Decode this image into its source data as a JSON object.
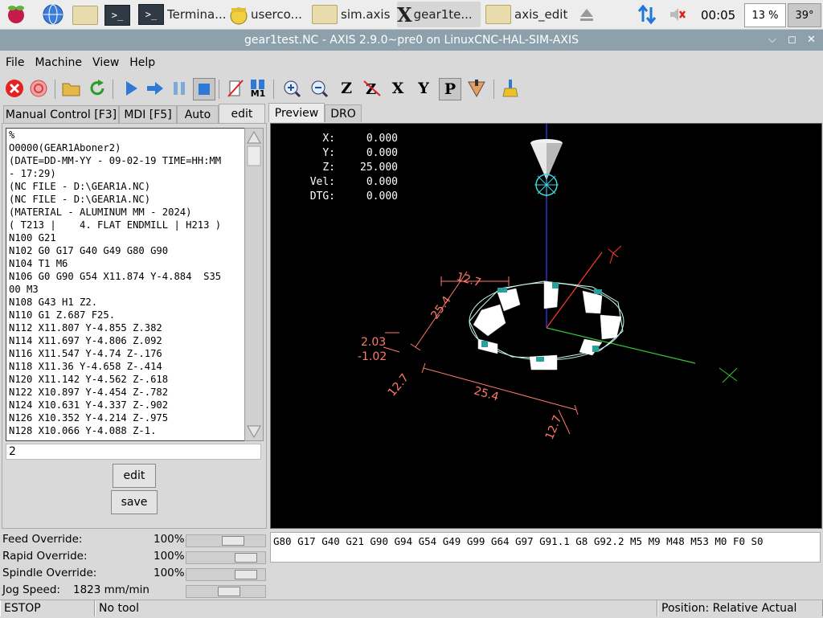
{
  "taskbar": {
    "tasks": [
      {
        "label": "Termina..."
      },
      {
        "label": "userco..."
      },
      {
        "label": "sim.axis"
      },
      {
        "label": "gear1te..."
      },
      {
        "label": "axis_edit"
      }
    ],
    "clock": "00:05",
    "cpu": "13 %",
    "temp": "39°",
    "icons": [
      "raspberry-icon",
      "globe-icon",
      "folder-icon",
      "terminal-icon",
      "eject-icon",
      "network-icon",
      "volume-muted-icon"
    ]
  },
  "window": {
    "title": "gear1test.NC - AXIS 2.9.0~pre0 on LinuxCNC-HAL-SIM-AXIS"
  },
  "menu": {
    "file": "File",
    "machine": "Machine",
    "view": "View",
    "help": "Help"
  },
  "toolbar": {
    "z": "Z",
    "x": "X",
    "y": "Y",
    "p": "P",
    "m1": "M1"
  },
  "left_tabs": {
    "manual": "Manual Control [F3]",
    "mdi": "MDI [F5]",
    "auto": "Auto",
    "edit": "edit"
  },
  "editor_lines": [
    "%",
    "O0000(GEAR1Aboner2)",
    "(DATE=DD-MM-YY - 09-02-19 TIME=HH:MM",
    "- 17:29)",
    "(NC FILE - D:\\GEAR1A.NC)",
    "(NC FILE - D:\\GEAR1A.NC)",
    "(MATERIAL - ALUMINUM MM - 2024)",
    "( T213 |    4. FLAT ENDMILL | H213 )",
    "N100 G21",
    "N102 G0 G17 G40 G49 G80 G90",
    "N104 T1 M6",
    "N106 G0 G90 G54 X11.874 Y-4.884  S35",
    "00 M3",
    "N108 G43 H1 Z2.",
    "N110 G1 Z.687 F25.",
    "N112 X11.807 Y-4.855 Z.382",
    "N114 X11.697 Y-4.806 Z.092",
    "N116 X11.547 Y-4.74 Z-.176",
    "N118 X11.36 Y-4.658 Z-.414",
    "N120 X11.142 Y-4.562 Z-.618",
    "N122 X10.897 Y-4.454 Z-.782",
    "N124 X10.631 Y-4.337 Z-.902",
    "N126 X10.352 Y-4.214 Z-.975",
    "N128 X10.066 Y-4.088 Z-1."
  ],
  "line_input": "2",
  "buttons": {
    "edit": "edit",
    "save": "save"
  },
  "overrides": [
    {
      "label": "Feed Override:",
      "value": "100",
      "unit": "%",
      "level": 0.63
    },
    {
      "label": "Rapid Override:",
      "value": "100",
      "unit": "%",
      "level": 0.85
    },
    {
      "label": "Spindle Override:",
      "value": "100",
      "unit": "%",
      "level": 0.85
    },
    {
      "label": "Jog Speed:",
      "value": "1823 mm/min",
      "unit": "",
      "level": 0.56
    }
  ],
  "right_tabs": {
    "preview": "Preview",
    "dro": "DRO"
  },
  "dro": [
    {
      "label": "X:",
      "value": "0.000"
    },
    {
      "label": "Y:",
      "value": "0.000"
    },
    {
      "label": "Z:",
      "value": "25.000"
    },
    {
      "label": "Vel:",
      "value": "0.000"
    },
    {
      "label": "DTG:",
      "value": "0.000"
    }
  ],
  "preview_labels": {
    "dim_top": "12.7",
    "dim_side": "25.4",
    "dim_bottom": "25.4",
    "dim_left": "12.7",
    "dim_right": "12.7",
    "z_top": "2.03",
    "z_bottom": "-1.02",
    "axis_y": "Y",
    "axis_x": "X"
  },
  "active_gcodes": "G80 G17 G40 G21 G90 G94 G54 G49 G99 G64 G97 G91.1 G8 G92.2 M5 M9 M48 M53 M0 F0 S0",
  "status": {
    "estop": "ESTOP",
    "tool": "No tool",
    "position": "Position: Relative Actual"
  },
  "colors": {
    "title_bar": "#8da1ad",
    "preview_bg": "#000000",
    "dim_color": "#ff7a6a",
    "axis_x": "#34c534",
    "axis_z": "#3a3aff",
    "axis_y": "#ff3a2a",
    "tool": "#3ed6e0"
  }
}
